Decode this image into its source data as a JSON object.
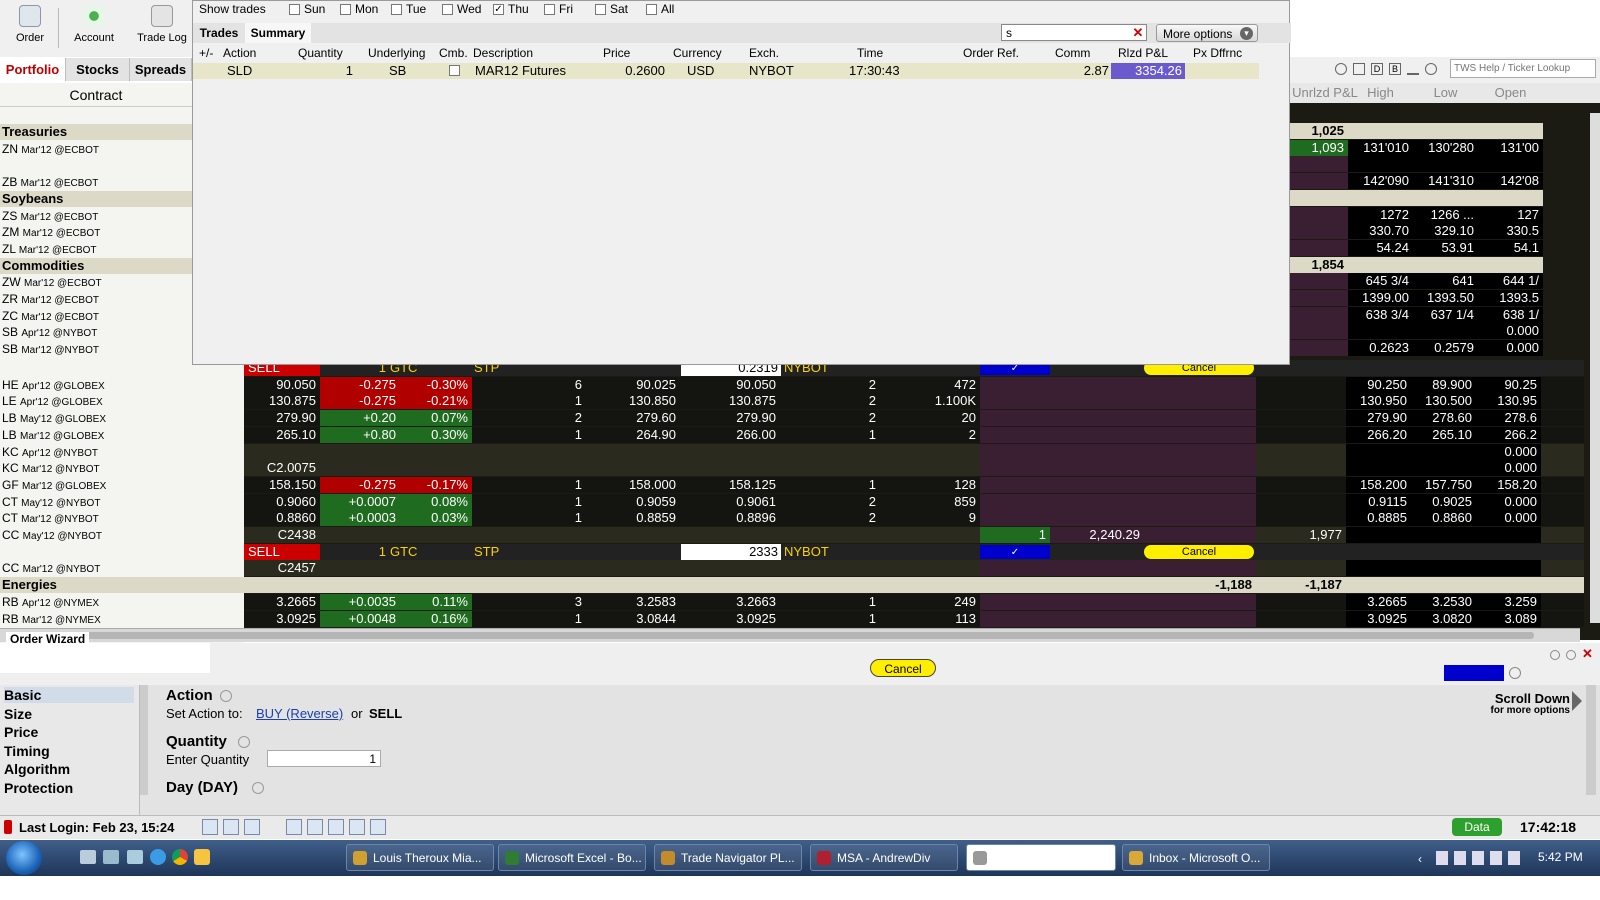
{
  "toolbar": {
    "order": "Order",
    "account": "Account",
    "trade_log": "Trade Log"
  },
  "left_tabs": [
    "Portfolio",
    "Stocks",
    "Spreads"
  ],
  "contract_header": "Contract",
  "contracts": [
    {
      "sym": "Treasuries",
      "exch": "",
      "group": true
    },
    {
      "sym": "ZN",
      "exch": "Mar'12 @ECBOT",
      "group": false
    },
    {
      "sym": "",
      "exch": "",
      "group": false
    },
    {
      "sym": "ZB",
      "exch": "Mar'12 @ECBOT",
      "group": false
    },
    {
      "sym": "Soybeans",
      "exch": "",
      "group": true
    },
    {
      "sym": "ZS",
      "exch": "Mar'12 @ECBOT",
      "group": false
    },
    {
      "sym": "ZM",
      "exch": "Mar'12 @ECBOT",
      "group": false
    },
    {
      "sym": "ZL",
      "exch": "Mar'12 @ECBOT",
      "group": false
    },
    {
      "sym": "Commodities",
      "exch": "",
      "group": true
    },
    {
      "sym": "ZW",
      "exch": "Mar'12 @ECBOT",
      "group": false
    },
    {
      "sym": "ZR",
      "exch": "Mar'12 @ECBOT",
      "group": false
    },
    {
      "sym": "ZC",
      "exch": "Mar'12 @ECBOT",
      "group": false
    },
    {
      "sym": "SB",
      "exch": "Apr'12 @NYBOT",
      "group": false
    },
    {
      "sym": "SB",
      "exch": "Mar'12 @NYBOT",
      "group": false
    }
  ],
  "trade_window": {
    "show_trades_label": "Show trades",
    "days": [
      {
        "label": "Sun",
        "checked": false
      },
      {
        "label": "Mon",
        "checked": false
      },
      {
        "label": "Tue",
        "checked": false
      },
      {
        "label": "Wed",
        "checked": false
      },
      {
        "label": "Thu",
        "checked": true
      },
      {
        "label": "Fri",
        "checked": false
      },
      {
        "label": "Sat",
        "checked": false
      },
      {
        "label": "All",
        "checked": false
      }
    ],
    "tabs": [
      "Trades",
      "Summary"
    ],
    "filter_value": "s",
    "more_options": "More options",
    "columns": [
      "+/-",
      "Action",
      "Quantity",
      "Underlying",
      "Cmb.",
      "Description",
      "Price",
      "Currency",
      "Exch.",
      "Time",
      "Order Ref.",
      "Comm",
      "Rlzd P&L",
      "Px Dffrnc"
    ],
    "rows": [
      {
        "action": "SLD",
        "quantity": "1",
        "underlying": "SB",
        "description": "MAR12 Futures",
        "price": "0.2600",
        "currency": "USD",
        "exch": "NYBOT",
        "time": "17:30:43",
        "comm": "2.87",
        "rlzd": "3354.26"
      }
    ]
  },
  "right_header": {
    "search_placeholder": "TWS Help / Ticker Lookup",
    "columns": [
      "Unrlzd P&L",
      "High",
      "Low",
      "Open"
    ]
  },
  "right_rows": [
    {
      "pnl": "1,025",
      "high": "",
      "low": "",
      "open": ""
    },
    {
      "pnl": "1,093",
      "high": "131'010",
      "low": "130'280",
      "open": "131'00"
    },
    {
      "pnl": "",
      "high": "",
      "low": "",
      "open": ""
    },
    {
      "pnl": "",
      "high": "142'090",
      "low": "141'310",
      "open": "142'08"
    },
    {
      "pnl": "",
      "high": "",
      "low": "",
      "open": ""
    },
    {
      "pnl": "",
      "high": "1272",
      "low": "1266 ...",
      "open": "127"
    },
    {
      "pnl": "",
      "high": "330.70",
      "low": "329.10",
      "open": "330.5"
    },
    {
      "pnl": "",
      "high": "54.24",
      "low": "53.91",
      "open": "54.1"
    },
    {
      "pnl": "1,854",
      "high": "",
      "low": "",
      "open": ""
    },
    {
      "pnl": "",
      "high": "645 3/4",
      "low": "641",
      "open": "644 1/"
    },
    {
      "pnl": "",
      "high": "1399.00",
      "low": "1393.50",
      "open": "1393.5"
    },
    {
      "pnl": "",
      "high": "638 3/4",
      "low": "637 1/4",
      "open": "638 1/"
    },
    {
      "pnl": "",
      "high": "",
      "low": "",
      "open": "0.000"
    },
    {
      "pnl": "",
      "high": "0.2623",
      "low": "0.2579",
      "open": "0.000"
    }
  ],
  "order_row_1": {
    "side": "SELL",
    "qty": "1",
    "tif": "GTC",
    "type": "STP",
    "price": "0.2319",
    "exch": "NYBOT",
    "cancel": "Cancel"
  },
  "grid_rows": [
    {
      "sym": "HE",
      "exch": "Apr'12 @GLOBEX",
      "last": "90.050",
      "chg": "-0.275",
      "pct": "-0.30%",
      "bsz": "6",
      "bid": "90.025",
      "ask": "90.050",
      "asz": "2",
      "vol": "472",
      "high": "90.250",
      "low": "89.900",
      "open": "90.25",
      "dir": "neg"
    },
    {
      "sym": "LE",
      "exch": "Apr'12 @GLOBEX",
      "last": "130.875",
      "chg": "-0.275",
      "pct": "-0.21%",
      "bsz": "1",
      "bid": "130.850",
      "ask": "130.875",
      "asz": "2",
      "vol": "1.100K",
      "high": "130.950",
      "low": "130.500",
      "open": "130.95",
      "dir": "neg"
    },
    {
      "sym": "LB",
      "exch": "May'12 @GLOBEX",
      "last": "279.90",
      "chg": "+0.20",
      "pct": "0.07%",
      "bsz": "2",
      "bid": "279.60",
      "ask": "279.90",
      "asz": "2",
      "vol": "20",
      "high": "279.90",
      "low": "278.60",
      "open": "278.6",
      "dir": "pos"
    },
    {
      "sym": "LB",
      "exch": "Mar'12 @GLOBEX",
      "last": "265.10",
      "chg": "+0.80",
      "pct": "0.30%",
      "bsz": "1",
      "bid": "264.90",
      "ask": "266.00",
      "asz": "1",
      "vol": "2",
      "high": "266.20",
      "low": "265.10",
      "open": "266.2",
      "dir": "pos"
    },
    {
      "sym": "KC",
      "exch": "Apr'12 @NYBOT",
      "last": "",
      "chg": "",
      "pct": "",
      "bsz": "",
      "bid": "",
      "ask": "",
      "asz": "",
      "vol": "",
      "high": "",
      "low": "",
      "open": "0.000",
      "dir": ""
    },
    {
      "sym": "KC",
      "exch": "Mar'12 @NYBOT",
      "last": "C2.0075",
      "chg": "",
      "pct": "",
      "bsz": "",
      "bid": "",
      "ask": "",
      "asz": "",
      "vol": "",
      "high": "",
      "low": "",
      "open": "0.000",
      "dir": ""
    },
    {
      "sym": "GF",
      "exch": "Mar'12 @GLOBEX",
      "last": "158.150",
      "chg": "-0.275",
      "pct": "-0.17%",
      "bsz": "1",
      "bid": "158.000",
      "ask": "158.125",
      "asz": "1",
      "vol": "128",
      "high": "158.200",
      "low": "157.750",
      "open": "158.20",
      "dir": "neg"
    },
    {
      "sym": "CT",
      "exch": "May'12 @NYBOT",
      "last": "0.9060",
      "chg": "+0.0007",
      "pct": "0.08%",
      "bsz": "1",
      "bid": "0.9059",
      "ask": "0.9061",
      "asz": "2",
      "vol": "859",
      "high": "0.9115",
      "low": "0.9025",
      "open": "0.000",
      "dir": "pos"
    },
    {
      "sym": "CT",
      "exch": "Mar'12 @NYBOT",
      "last": "0.8860",
      "chg": "+0.0003",
      "pct": "0.03%",
      "bsz": "1",
      "bid": "0.8859",
      "ask": "0.8896",
      "asz": "2",
      "vol": "9",
      "high": "0.8885",
      "low": "0.8860",
      "open": "0.000",
      "dir": "pos"
    },
    {
      "sym": "CC",
      "exch": "May'12 @NYBOT",
      "last": "C2438",
      "chg": "",
      "pct": "",
      "bsz": "",
      "bid": "",
      "ask": "",
      "asz": "",
      "vol": "",
      "high": "",
      "low": "",
      "open": "",
      "dir": "",
      "pos": "1",
      "avg": "2,240.29",
      "upnl": "1,977"
    }
  ],
  "order_row_2": {
    "side": "SELL",
    "qty": "1",
    "tif": "GTC",
    "type": "STP",
    "price": "2333",
    "exch": "NYBOT",
    "cancel": "Cancel"
  },
  "cc_mar": {
    "sym": "CC",
    "exch": "Mar'12 @NYBOT",
    "last": "C2457"
  },
  "energies": {
    "label": "Energies",
    "v1": "-1,188",
    "v2": "-1,187"
  },
  "rb_rows": [
    {
      "sym": "RB",
      "exch": "Apr'12 @NYMEX",
      "last": "3.2665",
      "chg": "+0.0035",
      "pct": "0.11%",
      "bsz": "3",
      "bid": "3.2583",
      "ask": "3.2663",
      "asz": "1",
      "vol": "249",
      "high": "3.2665",
      "low": "3.2530",
      "open": "3.259"
    },
    {
      "sym": "RB",
      "exch": "Mar'12 @NYMEX",
      "last": "3.0925",
      "chg": "+0.0048",
      "pct": "0.16%",
      "bsz": "1",
      "bid": "3.0844",
      "ask": "3.0925",
      "asz": "1",
      "vol": "113",
      "high": "3.0925",
      "low": "3.0820",
      "open": "3.089"
    }
  ],
  "wizard": {
    "title": "Order Wizard",
    "cancel": "Cancel",
    "nav": [
      "Basic",
      "Size",
      "Price",
      "Timing",
      "Algorithm",
      "Protection"
    ],
    "action_head": "Action",
    "set_action": "Set Action to:",
    "buy_link": "BUY (Reverse)",
    "or_text": "or",
    "sell_text": "SELL",
    "quantity_head": "Quantity",
    "enter_quantity": "Enter Quantity",
    "quantity_value": "1",
    "day_head": "Day (DAY)",
    "scroll_down": "Scroll Down",
    "more_opts": "for more options"
  },
  "status": {
    "last_login": "Last Login: Feb 23, 15:24",
    "data": "Data",
    "time": "17:42:18"
  },
  "taskbar": {
    "items": [
      "Louis Theroux Mia...",
      "Microsoft Excel - Bo...",
      "Trade Navigator PL...",
      "MSA - AndrewDiv",
      "",
      "Inbox - Microsoft O..."
    ],
    "clock": "5:42 PM"
  },
  "colors": {
    "grid_bg": "#1b1b14",
    "neg": "#b00000",
    "pos": "#1f6b1f",
    "accent_blue": "#0000cc",
    "cancel_yellow": "#ffee00"
  }
}
